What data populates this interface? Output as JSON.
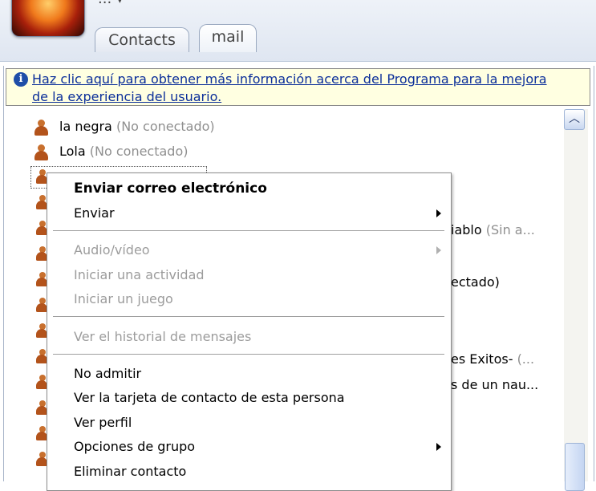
{
  "header": {
    "title_fragment": "... ▾",
    "tabs": [
      {
        "label": "Contacts"
      },
      {
        "label": "mail"
      }
    ]
  },
  "info_bar": {
    "line1": "Haz clic aquí para obtener más información acerca del Programa para la mejora",
    "line2": "de la experiencia del usuario."
  },
  "contacts": [
    {
      "name": "la negra",
      "status": "(No conectado)"
    },
    {
      "name": "Lola",
      "status": "(No conectado)"
    }
  ],
  "partially_visible": {
    "diablo": "iablo",
    "diablo_status": "(Sin a...",
    "ectado": "ectado)",
    "exitos": "es Exitos-",
    "exitos_status": "(...",
    "nau": "s de un nau..."
  },
  "context_menu": {
    "items": [
      {
        "label": "Enviar correo electrónico",
        "bold": true,
        "disabled": false
      },
      {
        "label": "Enviar",
        "disabled": false,
        "submenu": true
      },
      {
        "label": "Audio/vídeo",
        "disabled": true,
        "submenu": true
      },
      {
        "label": "Iniciar una actividad",
        "disabled": true
      },
      {
        "label": "Iniciar un juego",
        "disabled": true
      },
      {
        "label": "Ver el historial de mensajes",
        "disabled": true
      },
      {
        "label": "No admitir",
        "disabled": false
      },
      {
        "label": "Ver la tarjeta de contacto de esta persona",
        "disabled": false
      },
      {
        "label": "Ver perfil",
        "disabled": false
      },
      {
        "label": "Opciones de grupo",
        "disabled": false,
        "submenu": true
      },
      {
        "label": "Eliminar contacto",
        "disabled": false
      }
    ]
  },
  "colors": {
    "info_bar_bg": "#ffffe1",
    "link": "#0c2f9a",
    "status_text": "#8f8f8f"
  }
}
